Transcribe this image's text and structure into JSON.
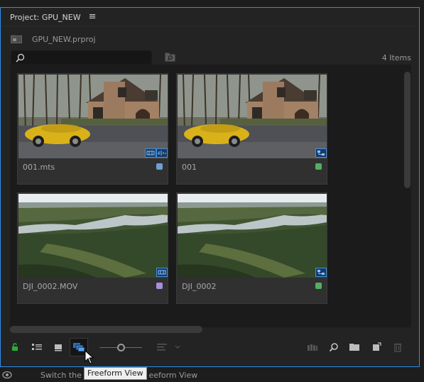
{
  "panel": {
    "title": "Project: GPU_NEW",
    "menu_icon": "hamburger-menu-icon",
    "accent": "#2d8ceb"
  },
  "project": {
    "file_name": "GPU_NEW.prproj",
    "icon": "project-bin-icon"
  },
  "search": {
    "value": "",
    "placeholder": "",
    "icon": "search-icon"
  },
  "items_count": "4 Items",
  "items": [
    {
      "name": "001.mts",
      "label_color": "#6e9fd2",
      "thumbnail": "yellow-convertible-house",
      "badges": [
        "video-clip-icon",
        "audio-clip-icon"
      ]
    },
    {
      "name": "001",
      "label_color": "#50b060",
      "thumbnail": "yellow-convertible-house",
      "badges": [
        "sequence-icon"
      ]
    },
    {
      "name": "DJI_0002.MOV",
      "label_color": "#a98ee0",
      "thumbnail": "aerial-forest-river",
      "badges": [
        "video-clip-icon"
      ]
    },
    {
      "name": "DJI_0002",
      "label_color": "#50b060",
      "thumbnail": "aerial-forest-river",
      "badges": [
        "sequence-icon"
      ]
    }
  ],
  "toolbar": {
    "buttons": [
      "lock-icon",
      "list-view-icon",
      "icon-view-icon",
      "freeform-view-icon",
      "zoom-slider",
      "sort-icon",
      "automate-to-sequence-icon",
      "find-icon",
      "new-bin-icon",
      "new-item-icon",
      "trash-icon"
    ],
    "active": "freeform-view-icon",
    "zoom_level": 0.42
  },
  "tooltip": "Freeform View",
  "status": {
    "text": "Switch the current bin to Freeform View",
    "visible_left": "Switch the c",
    "visible_right": "eeform View"
  }
}
